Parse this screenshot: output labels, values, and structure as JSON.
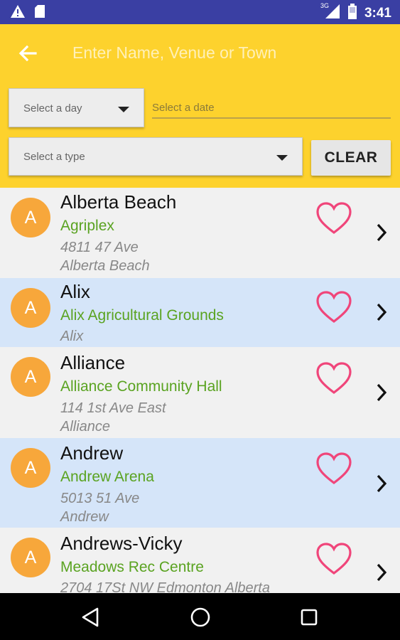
{
  "status_bar": {
    "time": "3:41",
    "network_label": "3G",
    "icons": [
      "warning-icon",
      "sd-card-icon",
      "signal-icon",
      "battery-icon"
    ]
  },
  "toolbar": {
    "search_placeholder": "Enter Name, Venue or Town",
    "back_icon": "arrow-left-icon"
  },
  "filters": {
    "day_label": "Select a day",
    "date_label": "Select a date",
    "type_label": "Select a type",
    "clear_label": "CLEAR"
  },
  "list": {
    "items": [
      {
        "initial": "A",
        "town": "Alberta Beach",
        "venue": "Agriplex",
        "address_line1": "4811 47 Ave",
        "address_line2": "Alberta Beach"
      },
      {
        "initial": "A",
        "town": "Alix",
        "venue": "Alix Agricultural Grounds",
        "address_line1": "Alix",
        "address_line2": ""
      },
      {
        "initial": "A",
        "town": "Alliance",
        "venue": "Alliance Community Hall",
        "address_line1": "114 1st Ave East",
        "address_line2": "Alliance"
      },
      {
        "initial": "A",
        "town": "Andrew",
        "venue": "Andrew Arena",
        "address_line1": "5013 51 Ave",
        "address_line2": "Andrew"
      },
      {
        "initial": "A",
        "town": "Andrews-Vicky",
        "venue": "Meadows Rec Centre",
        "address_line1": "2704 17St NW Edmonton Alberta",
        "address_line2": ""
      }
    ]
  },
  "colors": {
    "status_bar": "#3a3fa3",
    "toolbar": "#fdd22d",
    "avatar": "#f7a73b",
    "venue_text": "#5aa321",
    "heart": "#f0457a",
    "row_highlight": "#d5e5f9"
  },
  "nav_bar": {
    "icons": [
      "back-triangle-icon",
      "home-circle-icon",
      "recents-square-icon"
    ]
  }
}
